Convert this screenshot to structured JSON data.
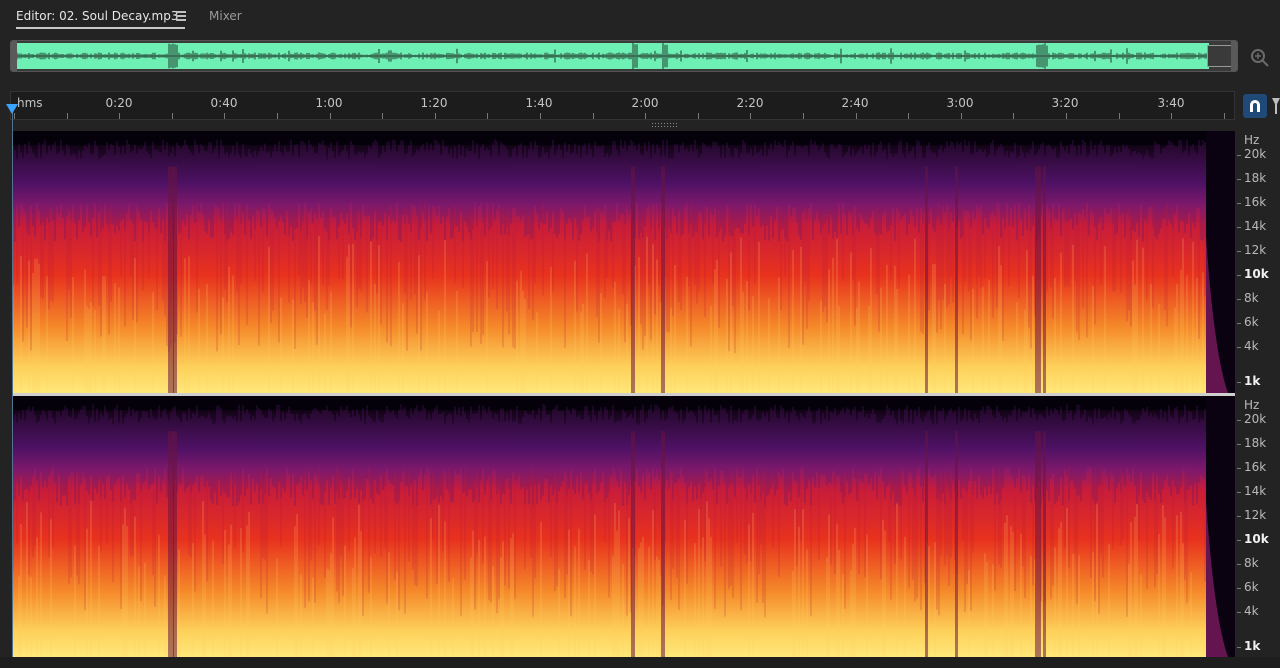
{
  "tabs": {
    "editor_label": "Editor: 02. Soul Decay.mp3",
    "mixer_label": "Mixer"
  },
  "icons": {
    "tab_menu": "hamburger-icon",
    "zoom": "zoom-icon",
    "snap": "magnet-icon",
    "filter": "filter-icon"
  },
  "colors": {
    "overview_wave_bg": "#6ef0b4",
    "playhead": "#3aa3ff",
    "accent_button": "#1f4a77"
  },
  "ruler": {
    "unit_label": "hms",
    "labels": [
      "0:20",
      "0:40",
      "1:00",
      "1:20",
      "1:40",
      "2:00",
      "2:20",
      "2:40",
      "3:00",
      "3:20",
      "3:40"
    ]
  },
  "channels": [
    {
      "hz_header": "Hz",
      "hz_labels": [
        "20k",
        "18k",
        "16k",
        "14k",
        "12k",
        "10k",
        "8k",
        "6k",
        "4k",
        "1k"
      ]
    },
    {
      "hz_header": "Hz",
      "hz_labels": [
        "20k",
        "18k",
        "16k",
        "14k",
        "12k",
        "10k",
        "8k",
        "6k",
        "4k",
        "1k"
      ]
    }
  ]
}
